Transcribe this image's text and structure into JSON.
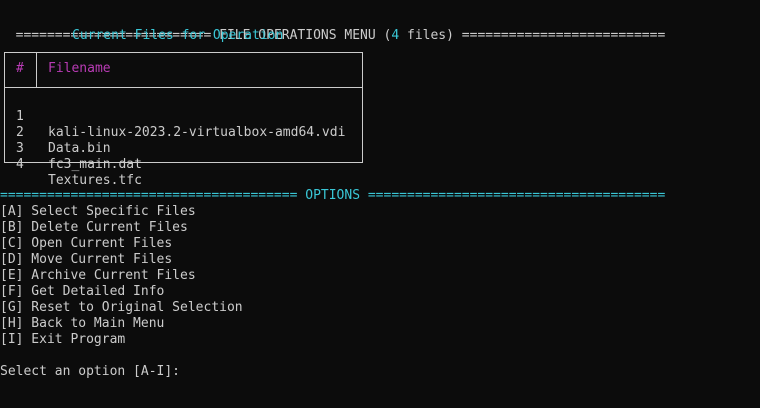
{
  "header": {
    "left_rule": "========================= ",
    "title": "FILE OPERATIONS MENU (",
    "count": "4",
    "title_suffix": " files)",
    "right_rule": " =========================="
  },
  "subtitle": "Current Files for Operation",
  "table": {
    "col_num": "#",
    "col_name": "Filename",
    "rows": [
      {
        "idx": "1",
        "name": "kali-linux-2023.2-virtualbox-amd64.vdi"
      },
      {
        "idx": "2",
        "name": "Data.bin"
      },
      {
        "idx": "3",
        "name": "fc3_main.dat"
      },
      {
        "idx": "4",
        "name": "Textures.tfc"
      }
    ]
  },
  "options_header": "====================================== OPTIONS ======================================",
  "options": [
    "[A] Select Specific Files",
    "[B] Delete Current Files",
    "[C] Open Current Files",
    "[D] Move Current Files",
    "[E] Archive Current Files",
    "[F] Get Detailed Info",
    "[G] Reset to Original Selection",
    "[H] Back to Main Menu",
    "[I] Exit Program"
  ],
  "prompt": "Select an option [A-I]: ",
  "colors": {
    "background": "#0c0c0c",
    "text": "#cccccc",
    "cyan": "#3ac7d6",
    "purple": "#b93bb5"
  }
}
